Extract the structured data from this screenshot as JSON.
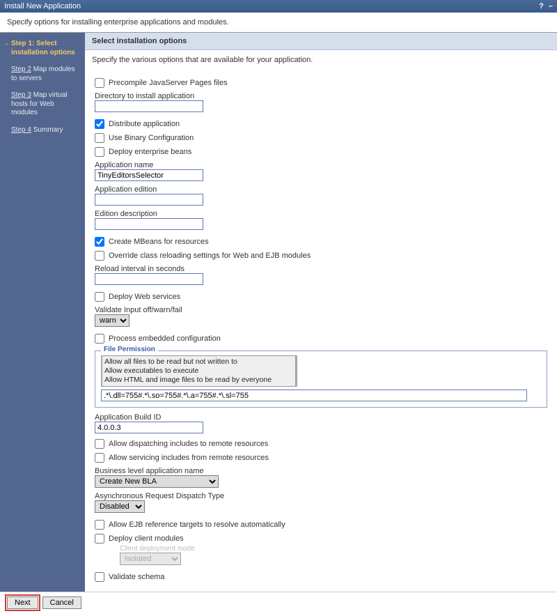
{
  "titlebar": {
    "title": "Install New Application",
    "help": "?",
    "min": "–"
  },
  "instructions": "Specify options for installing enterprise applications and modules.",
  "sidebar": {
    "steps": [
      {
        "label": "Step 1: Select installation options",
        "current": true
      },
      {
        "link": "Step 2",
        "rest": " Map modules to servers"
      },
      {
        "link": "Step 3",
        "rest": " Map virtual hosts for Web modules"
      },
      {
        "link": "Step 4",
        "rest": " Summary"
      }
    ]
  },
  "main": {
    "header": "Select installation options",
    "sub": "Specify the various options that are available for your application.",
    "precompile": "Precompile JavaServer Pages files",
    "dir_label": "Directory to install application",
    "dir_value": "",
    "distribute": "Distribute application",
    "use_binary": "Use Binary Configuration",
    "deploy_ejb": "Deploy enterprise beans",
    "app_name_label": "Application name",
    "app_name_value": "TinyEditorsSelector",
    "app_edition_label": "Application edition",
    "app_edition_value": "",
    "edition_desc_label": "Edition description",
    "edition_desc_value": "",
    "create_mbeans": "Create MBeans for resources",
    "override_reload": "Override class reloading settings for Web and EJB modules",
    "reload_label": "Reload interval in seconds",
    "reload_value": "",
    "deploy_ws": "Deploy Web services",
    "validate_label": "Validate Input off/warn/fail",
    "validate_value": "warn",
    "process_embedded": "Process embedded configuration",
    "file_perm_legend": "File Permission",
    "perm_opts": [
      "Allow all files to be read but not written to",
      "Allow executables to execute",
      "Allow HTML and image files to be read by everyone"
    ],
    "perm_expr": ".*\\.dll=755#.*\\.so=755#.*\\.a=755#.*\\.sl=755",
    "build_id_label": "Application Build ID",
    "build_id_value": "4.0.0.3",
    "allow_dispatch": "Allow dispatching includes to remote resources",
    "allow_servicing": "Allow servicing includes from remote resources",
    "bla_label": "Business level application name",
    "bla_value": "Create New BLA",
    "ardt_label": "Asynchronous Request Dispatch Type",
    "ardt_value": "Disabled",
    "allow_ejb_ref": "Allow EJB reference targets to resolve automatically",
    "deploy_client": "Deploy client modules",
    "client_mode_label": "Client deployment mode",
    "client_mode_value": "Isolated",
    "validate_schema": "Validate schema"
  },
  "buttons": {
    "next": "Next",
    "cancel": "Cancel"
  }
}
